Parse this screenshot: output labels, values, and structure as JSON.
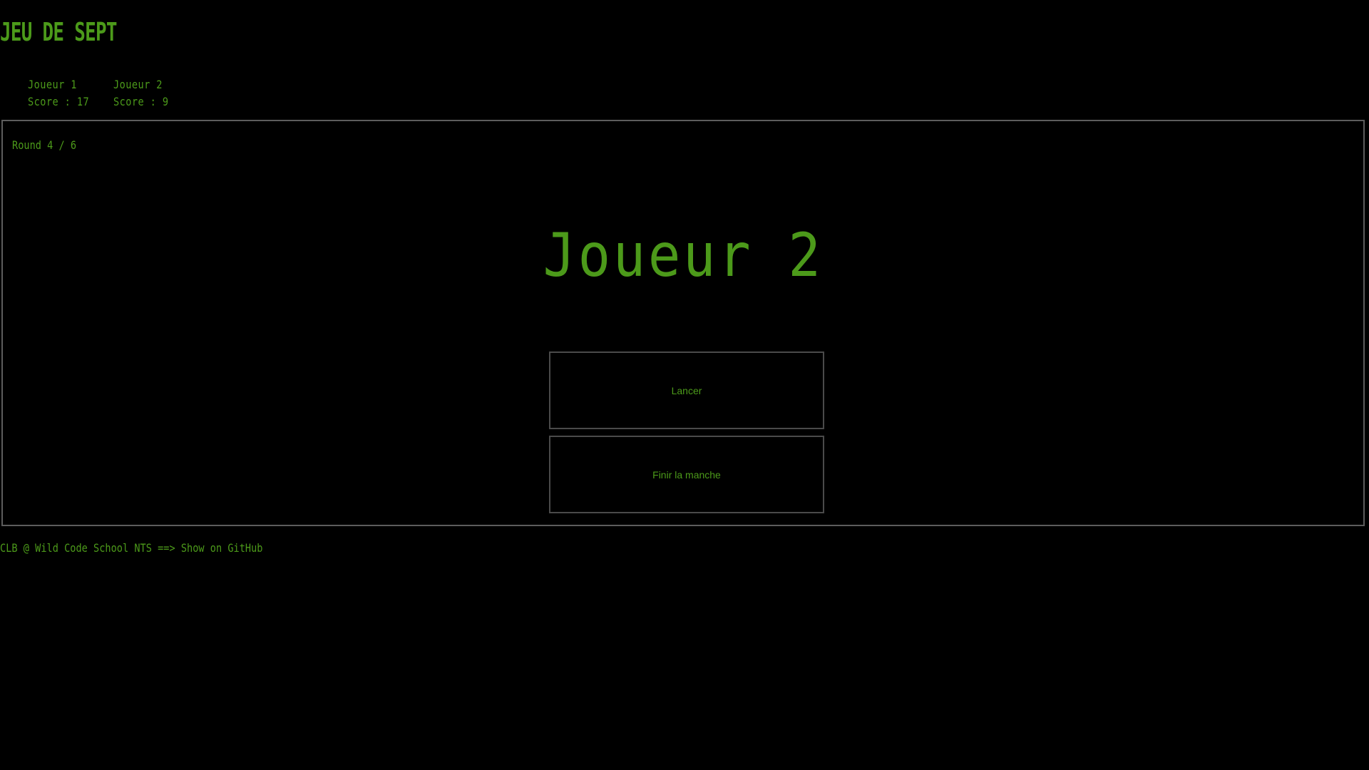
{
  "app": {
    "title": "JEU DE SEPT"
  },
  "players": [
    {
      "name": "Joueur 1",
      "score_text": "Score : 17"
    },
    {
      "name": "Joueur 2",
      "score_text": "Score : 9"
    }
  ],
  "board": {
    "round_text": "Round 4 / 6",
    "current_player": "Joueur 2",
    "roll_label": "Lancer",
    "end_round_label": "Finir la manche"
  },
  "footer": {
    "credit_text": "CLB @ Wild Code School NTS ==> ",
    "github_link": "Show on GitHub"
  },
  "colors": {
    "background": "#000000",
    "accent": "#4c9a1a",
    "border": "#5d5d5d"
  }
}
